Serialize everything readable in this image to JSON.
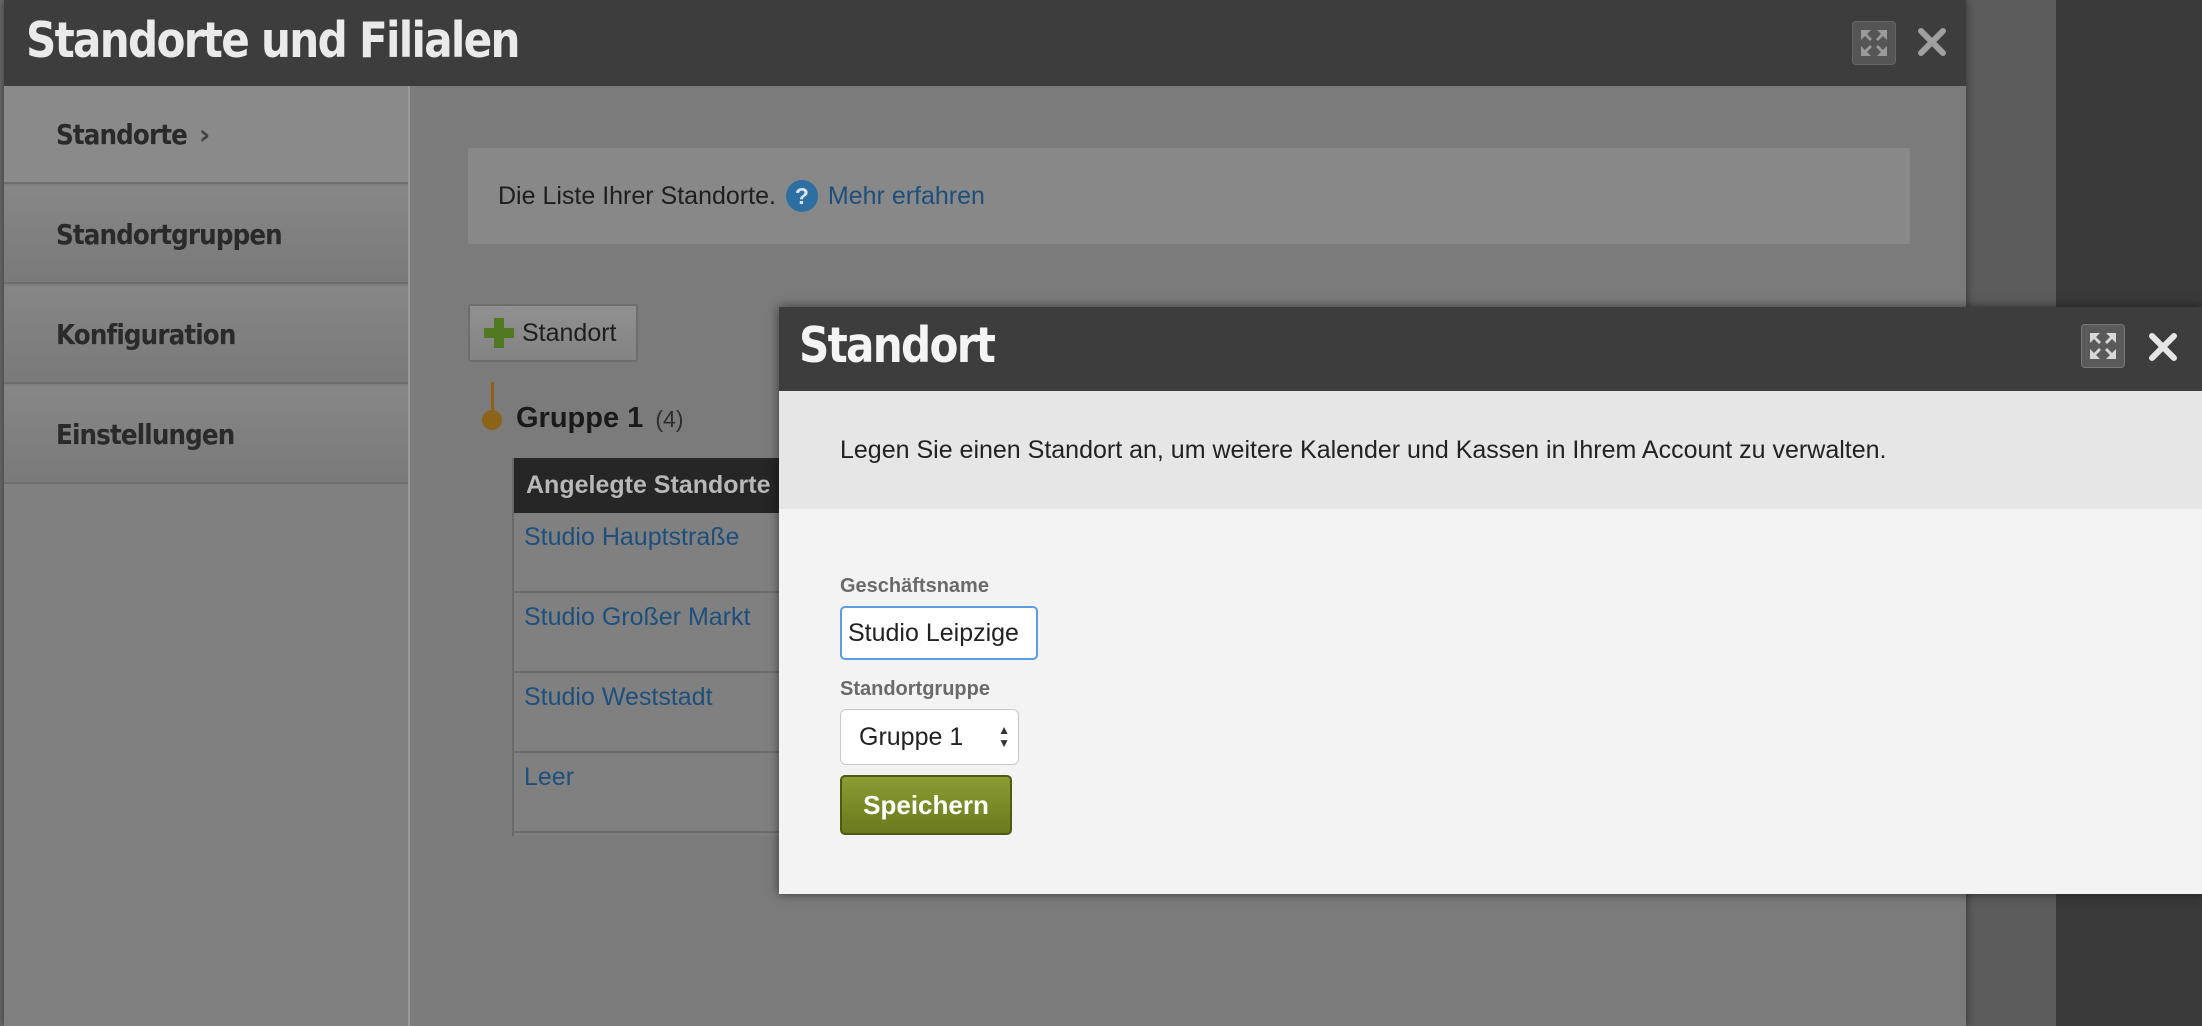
{
  "main_dialog": {
    "title": "Standorte und Filialen",
    "buttons": {
      "expand_icon": "expand-icon",
      "close_icon": "close-icon"
    }
  },
  "sidebar": {
    "items": [
      {
        "label": "Standorte",
        "active": true
      },
      {
        "label": "Standortgruppen",
        "active": false
      },
      {
        "label": "Konfiguration",
        "active": false
      },
      {
        "label": "Einstellungen",
        "active": false
      }
    ]
  },
  "info": {
    "text": "Die Liste Ihrer Standorte.",
    "help_icon": "question-circle-icon",
    "link": "Mehr erfahren"
  },
  "add_button": {
    "label": "Standort",
    "icon": "plus-icon"
  },
  "group": {
    "title": "Gruppe 1",
    "count": "(4)"
  },
  "table": {
    "header": "Angelegte Standorte",
    "rows": [
      "Studio Hauptstraße",
      "Studio Großer Markt",
      "Studio Weststadt",
      "Leer"
    ]
  },
  "modal": {
    "title": "Standort",
    "intro": "Legen Sie einen Standort an, um weitere Kalender und Kassen in Ihrem Account zu verwalten.",
    "name_label": "Geschäftsname",
    "name_value": "Studio Leipzige",
    "group_label": "Standortgruppe",
    "group_value": "Gruppe 1",
    "save_label": "Speichern"
  },
  "colors": {
    "titlebar": "#3d3d3d",
    "link": "#1d4f7d",
    "save_button": "#7a8c26",
    "group_accent": "#8c6418"
  }
}
